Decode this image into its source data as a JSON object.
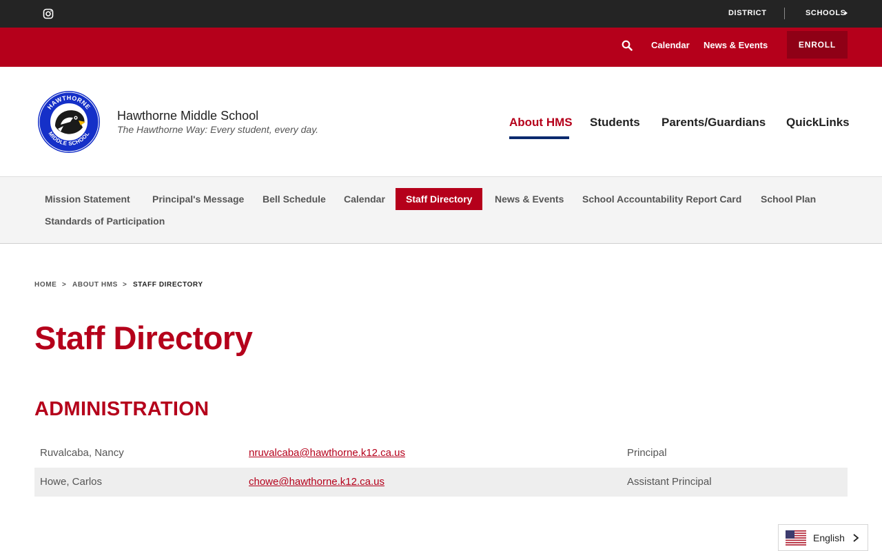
{
  "topbar": {
    "instagram_icon": "instagram-icon",
    "district_label": "DISTRICT",
    "schools_label": "SCHOOLS"
  },
  "utility_nav": {
    "search_icon": "search-icon",
    "calendar_label": "Calendar",
    "news_label": "News & Events",
    "enroll_label": "ENROLL"
  },
  "header": {
    "logo_text_top": "HAWTHORNE",
    "logo_text_bottom": "MIDDLE SCHOOL",
    "school_name": "Hawthorne Middle School",
    "tagline": "The Hawthorne Way: Every student, every day."
  },
  "main_nav": {
    "items": [
      {
        "label": "About HMS",
        "active": true
      },
      {
        "label": "Students"
      },
      {
        "label": "Parents/Guardians"
      },
      {
        "label": "QuickLinks"
      }
    ]
  },
  "sub_nav": {
    "items": [
      {
        "label": "Mission Statement"
      },
      {
        "label": "Principal's Message"
      },
      {
        "label": "Bell Schedule"
      },
      {
        "label": "Calendar"
      },
      {
        "label": "Staff Directory",
        "active": true
      },
      {
        "label": "News & Events"
      },
      {
        "label": "School Accountability Report Card"
      },
      {
        "label": "School Plan"
      },
      {
        "label": "Standards of Participation"
      }
    ]
  },
  "breadcrumb": {
    "items": [
      "HOME",
      "ABOUT HMS",
      "STAFF DIRECTORY"
    ],
    "separator": ">"
  },
  "page": {
    "title": "Staff Directory",
    "section_title": "ADMINISTRATION"
  },
  "staff": [
    {
      "name": "Ruvalcaba, Nancy",
      "email": "nruvalcaba@hawthorne.k12.ca.us",
      "title": "Principal"
    },
    {
      "name": "Howe, Carlos",
      "email": "chowe@hawthorne.k12.ca.us",
      "title": "Assistant Principal"
    }
  ],
  "language": {
    "flag_icon": "us-flag-icon",
    "label": "English"
  },
  "colors": {
    "brand_red": "#b5001b",
    "dark_bar": "#242424",
    "nav_underline": "#0b2a6e"
  }
}
